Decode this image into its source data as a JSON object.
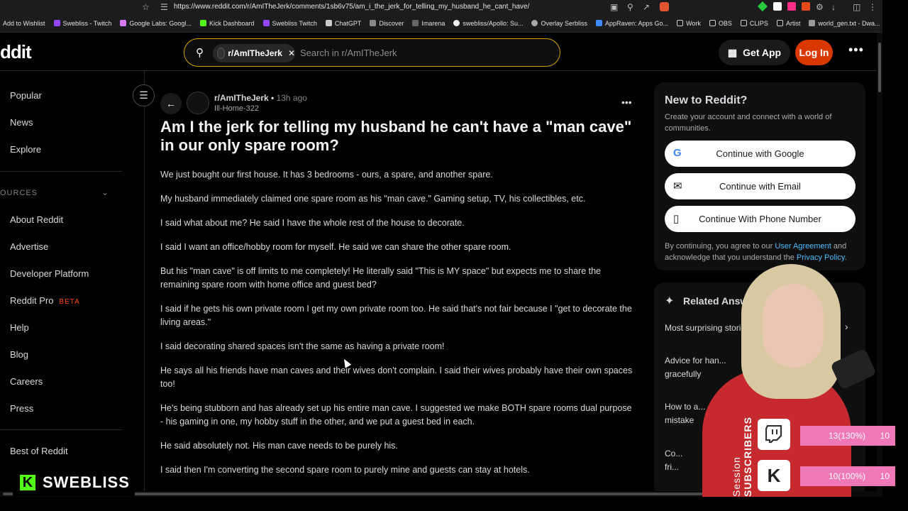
{
  "browser": {
    "url": "https://www.reddit.com/r/AmITheJerk/comments/1sb6v75/am_i_the_jerk_for_telling_my_husband_he_cant_have/",
    "bookmarks": [
      "Add to Wishlist",
      "Swebliss - Twitch",
      "Google Labs: Googl...",
      "Kick Dashboard",
      "Swebliss Twitch",
      "ChatGPT",
      "Discover",
      "Imarena",
      "swebliss/Apollo: Su...",
      "Overlay Serbliss",
      "AppRaven: Apps Go...",
      "Work",
      "OBS",
      "CLIPS",
      "Artist",
      "world_gen.txt - Dwa..."
    ]
  },
  "header": {
    "logo": "ddit",
    "search_chip": "r/AmITheJerk",
    "search_placeholder": "Search in r/AmITheJerk",
    "get_app": "Get App",
    "login": "Log In"
  },
  "sidebar": {
    "items": [
      "Popular",
      "News",
      "Explore"
    ],
    "section": "OURCES",
    "resources": [
      "About Reddit",
      "Advertise",
      "Developer Platform",
      "Reddit Pro",
      "Help",
      "Blog",
      "Careers",
      "Press"
    ],
    "beta": "BETA",
    "bottom": "Best of Reddit"
  },
  "post": {
    "subreddit": "r/AmITheJerk",
    "time": "13h ago",
    "author": "Ill-Home-322",
    "title": "Am I the jerk for telling my husband he can't have a \"man cave\" in our only spare room?",
    "paragraphs": [
      "We just bought our first house. It has 3 bedrooms - ours, a spare, and another spare.",
      "My husband immediately claimed one spare room as his \"man cave.\" Gaming setup, TV, his collectibles, etc.",
      "I said what about me? He said I have the whole rest of the house to decorate.",
      "I said I want an office/hobby room for myself. He said we can share the other spare room.",
      "But his \"man cave\" is off limits to me completely! He literally said \"This is MY space\" but expects me to share the remaining spare room with home office and guest bed?",
      "I said if he gets his own private room I get my own private room too. He said that's not fair because I \"get to decorate the living areas.\"",
      "I said decorating shared spaces isn't the same as having a private room!",
      "He says all his friends have man caves and their wives don't complain. I said their wives probably have their own spaces too!",
      "He's being stubborn and has already set up his entire man cave. I suggested we make BOTH spare rooms dual purpose - his gaming in one, my hobby stuff in the other, and we put a guest bed in each.",
      "He said absolutely not. His man cave needs to be purely his.",
      "I said then I'm converting the second spare room to purely mine and guests can stay at hotels."
    ]
  },
  "signup": {
    "title": "New to Reddit?",
    "subtitle": "Create your account and connect with a world of communities.",
    "google": "Continue with Google",
    "email": "Continue with Email",
    "phone": "Continue With Phone Number",
    "legal_pre": "By continuing, you agree to our ",
    "agreement": "User Agreement",
    "legal_mid": " and acknowledge that you understand the ",
    "privacy": "Privacy Policy",
    "legal_end": "."
  },
  "related": {
    "title": "Related Answers",
    "items": [
      "Most surprising stories",
      "Advice for han... gracefully",
      "How to a... mistake",
      "Co... fri..."
    ]
  },
  "overlay": {
    "session_label": "Session",
    "subscribers_label": "SUBSCRIBERS",
    "twitch_value": "13(130%)",
    "twitch_goal": "10",
    "kick_value": "10(100%)",
    "kick_goal": "10",
    "brand": "SWEBLISS",
    "brand_k": "K"
  },
  "colors": {
    "accent": "#d93900",
    "link": "#4fbcff",
    "overlay_bar": "#f178b6",
    "search_border": "#d8a300"
  }
}
